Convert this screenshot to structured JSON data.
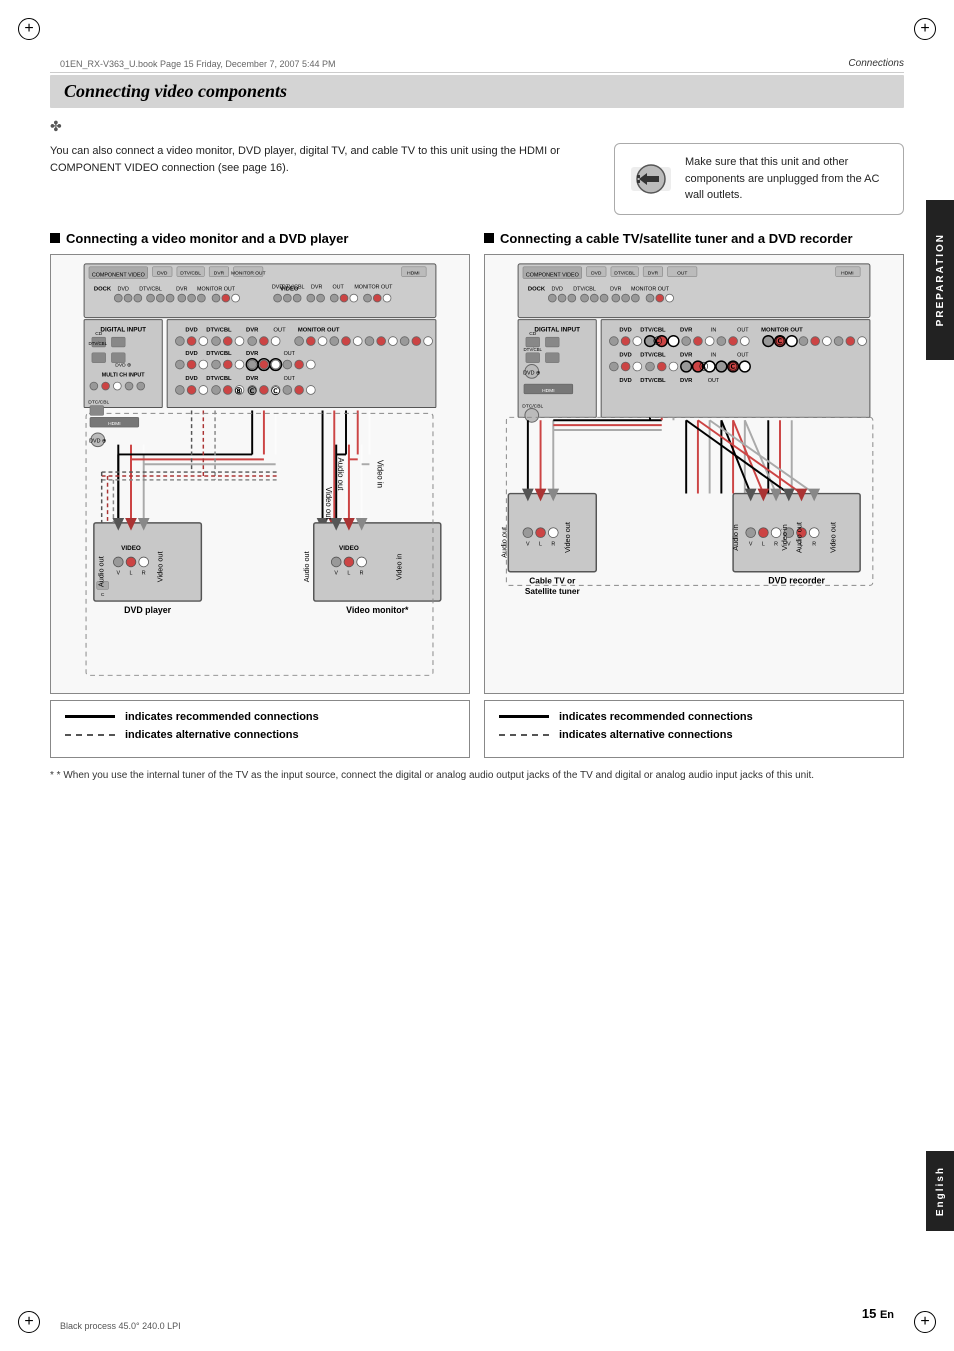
{
  "page": {
    "title": "Connecting video components",
    "section": "Connections",
    "file_info": "01EN_RX-V363_U.book  Page 15  Friday, December 7, 2007  5:44 PM",
    "page_number": "15",
    "page_suffix": "En",
    "bottom_info": "Black process 45.0° 240.0 LPI"
  },
  "tabs": {
    "preparation": "PREPARATION",
    "english": "English"
  },
  "note_icon": "✤",
  "intro_text": "You can also connect a video monitor, DVD player, digital TV, and cable TV to this unit using the HDMI or COMPONENT VIDEO connection (see page 16).",
  "warning_text": "Make sure that this unit and other components are unplugged from the AC wall outlets.",
  "sections": [
    {
      "heading": "Connecting a video monitor and a DVD player",
      "devices": [
        "DVD player",
        "Video monitor*"
      ]
    },
    {
      "heading": "Connecting a cable TV/satellite tuner and a DVD recorder",
      "devices": [
        "Cable TV or\nSatellite tuner",
        "DVD recorder"
      ]
    }
  ],
  "legend": {
    "recommended_label": "indicates recommended connections",
    "alternative_label": "indicates alternative connections"
  },
  "footnote": "* When you use the internal tuner of the TV as the input source, connect the digital or analog audio output jacks of the TV and digital or analog audio input jacks of this unit."
}
